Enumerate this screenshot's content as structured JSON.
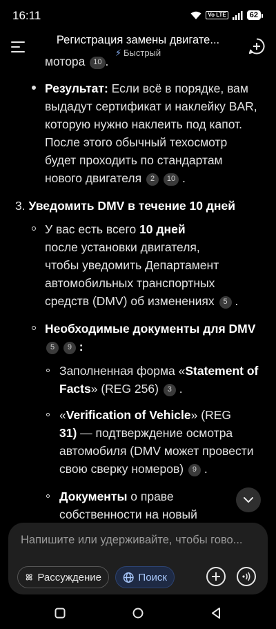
{
  "status": {
    "time": "16:11",
    "battery": "62",
    "network": "Vo LTE"
  },
  "header": {
    "title": "Регистрация замены двигате...",
    "model_label": "Быстрый",
    "icons": {
      "menu": "menu-icon",
      "new_chat": "new-chat-icon",
      "model": "bolt-icon"
    }
  },
  "content": {
    "partial_line": {
      "text": "мотора",
      "cite": "10",
      "end": "."
    },
    "result": {
      "label": "Результат:",
      "lines": [
        " Если всё в порядке, вам",
        "выдадут сертификат и наклейку BAR,",
        "которую нужно наклеить под капот.",
        "После этого обычный техосмотр",
        "будет проходить по стандартам",
        "нового двигателя"
      ],
      "cites": [
        "2",
        "10"
      ],
      "end": "."
    },
    "step3": {
      "number": "3.",
      "title": "Уведомить DMV в течение 10 дней",
      "bullet1": {
        "prefix": "У вас есть всего ",
        "bold": "10 дней",
        "lines": [
          "после установки двигателя,",
          "чтобы уведомить Департамент",
          "автомобильных транспортных",
          "средств (DMV) об изменениях"
        ],
        "cite": "5",
        "end": "."
      },
      "bullet2": {
        "title": "Необходимые документы для DMV",
        "cites": [
          "5",
          "9"
        ],
        "end": ":",
        "sub1": {
          "pre": "Заполненная форма «",
          "bold1": "Statement of",
          "bold2": "Facts",
          "post": "» (REG 256)",
          "cite": "3",
          "end": "."
        },
        "sub2": {
          "pre": "«",
          "bold1": "Verification of Vehicle",
          "mid": "» (REG",
          "line2_bold": "31)",
          "line2": " — подтверждение осмотра",
          "line3": "автомобиля (DMV может провести",
          "line4": "свою сверку номеров)",
          "cite": "9",
          "end": "."
        },
        "sub3": {
          "bold": "Документы",
          "text": " о праве",
          "line2": "собственности на новый"
        }
      }
    }
  },
  "input": {
    "placeholder": "Напишите или удерживайте, чтобы гово...",
    "reasoning_label": "Рассуждение",
    "search_label": "Поиск"
  },
  "colors": {
    "background": "#000000",
    "panel": "#1f1f1f",
    "accent": "#a8c7fa"
  }
}
